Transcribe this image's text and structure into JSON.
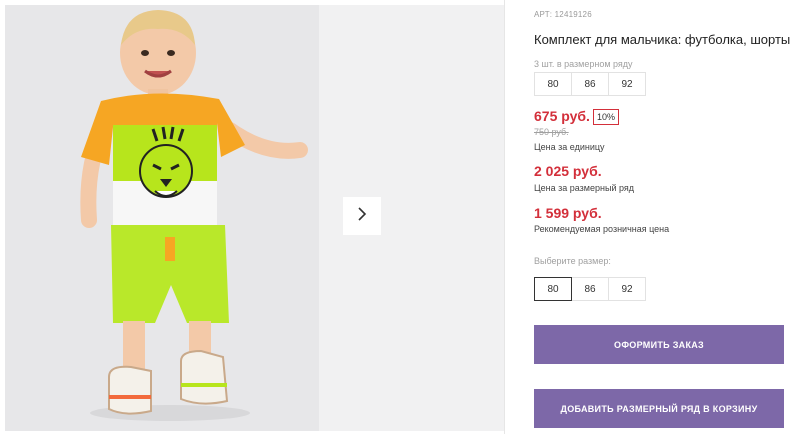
{
  "gallery": {
    "next_icon": "chevron-right-icon"
  },
  "product": {
    "article": "АРТ: 12419126",
    "title": "Комплект для мальчика: футболка, шорты",
    "range_note": "3 шт. в размерном ряду",
    "range_sizes": [
      "80",
      "86",
      "92"
    ],
    "price": "675 руб.",
    "discount": "10%",
    "old_price": "750 руб.",
    "price_unit_label": "Цена за единицу",
    "price_range": "2 025 руб.",
    "price_range_label": "Цена за размерный ряд",
    "price_retail": "1 599 руб.",
    "price_retail_label": "Рекомендуемая розничная цена",
    "choose_size_label": "Выберите размер:",
    "select_sizes": [
      "80",
      "86",
      "92"
    ],
    "selected_size": "80",
    "order_button": "ОФОРМИТЬ ЗАКАЗ",
    "cart_button": "ДОБАВИТЬ РАЗМЕРНЫЙ РЯД В КОРЗИНУ"
  },
  "colors": {
    "accent_button": "#7d68a8",
    "price_red": "#d32f3a"
  }
}
